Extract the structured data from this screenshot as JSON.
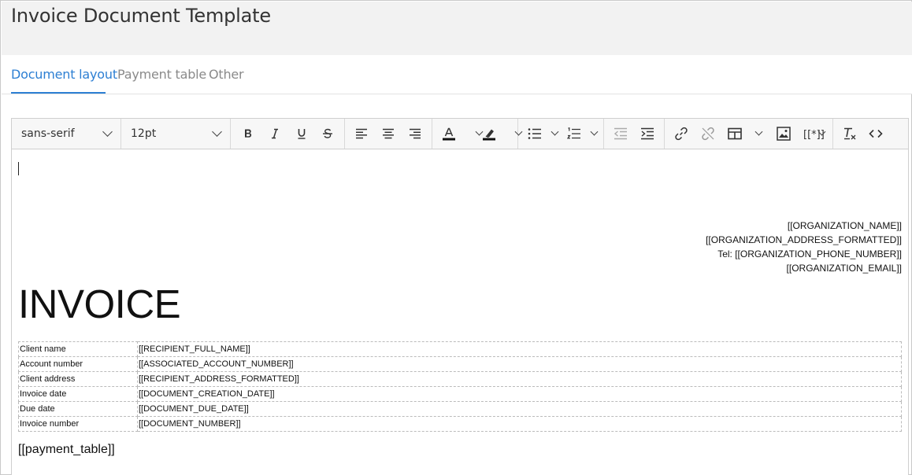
{
  "page": {
    "title": "Invoice Document Template"
  },
  "tabs": [
    {
      "label": "Document layout",
      "active": true
    },
    {
      "label": "Payment table",
      "active": false
    },
    {
      "label": "Other",
      "active": false
    }
  ],
  "toolbar": {
    "font_family": "sans-serif",
    "font_size": "12pt",
    "placeholder_menu": "[[*]]",
    "buttons": [
      "bold-icon",
      "italic-icon",
      "underline-icon",
      "strikethrough-icon",
      "align-left-icon",
      "align-center-icon",
      "align-right-icon",
      "text-color-icon",
      "highlight-icon",
      "bullet-list-icon",
      "numbered-list-icon",
      "outdent-icon",
      "indent-icon",
      "link-icon",
      "unlink-icon",
      "table-icon",
      "image-icon",
      "clear-format-icon",
      "source-code-icon"
    ]
  },
  "document": {
    "organization": {
      "name": "[[ORGANIZATION_NAME]]",
      "address": "[[ORGANIZATION_ADDRESS_FORMATTED]]",
      "phone": "Tel: [[ORGANIZATION_PHONE_NUMBER]]",
      "email": "[[ORGANIZATION_EMAIL]]"
    },
    "heading": "INVOICE",
    "details": [
      {
        "label": "Client name",
        "value": "[[RECIPIENT_FULL_NAME]]"
      },
      {
        "label": "Account number",
        "value": "[[ASSOCIATED_ACCOUNT_NUMBER]]"
      },
      {
        "label": "Client address",
        "value": "[[RECIPIENT_ADDRESS_FORMATTED]]"
      },
      {
        "label": "Invoice date",
        "value": "[[DOCUMENT_CREATION_DATE]]"
      },
      {
        "label": "Due date",
        "value": "[[DOCUMENT_DUE_DATE]]"
      },
      {
        "label": "Invoice number",
        "value": "[[DOCUMENT_NUMBER]]"
      }
    ],
    "payment_table": "[[payment_table]]"
  },
  "colors": {
    "accent": "#2d7fd3",
    "header_bg": "#f2f2f2",
    "toolbar_bg": "#f7f7f7"
  }
}
